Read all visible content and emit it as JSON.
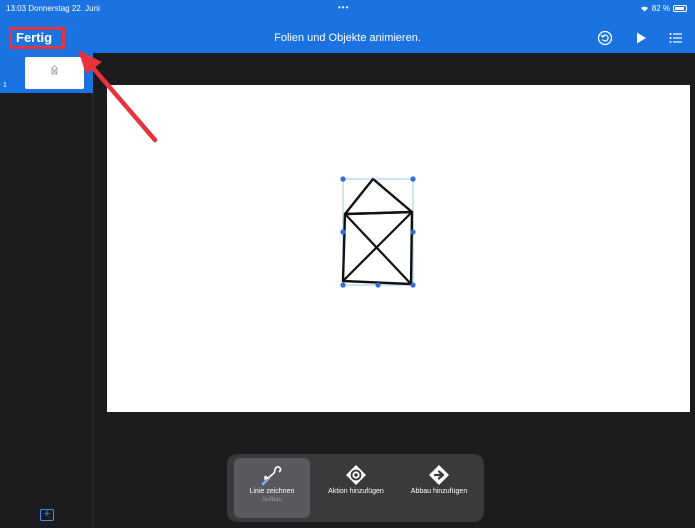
{
  "status_bar": {
    "time_date": "13:03  Donnerstag 22. Juni",
    "dots": "•••",
    "battery": "82 %"
  },
  "nav": {
    "done_label": "Fertig",
    "title": "Folien und Objekte animieren."
  },
  "sidebar": {
    "slides": [
      {
        "number": "1"
      }
    ],
    "add_icon": "plus-square-icon"
  },
  "toolbar": {
    "items": [
      {
        "label": "Linie zeichnen",
        "sublabel": "Aufbau",
        "icon": "draw-line-icon",
        "selected": true
      },
      {
        "label": "Aktion hinzufügen",
        "icon": "action-diamond-icon"
      },
      {
        "label": "Abbau hinzufügen",
        "icon": "build-out-diamond-icon"
      }
    ]
  },
  "colors": {
    "accent": "#1a73e0",
    "annotation": "#e8323c",
    "background": "#1c1c1e"
  }
}
